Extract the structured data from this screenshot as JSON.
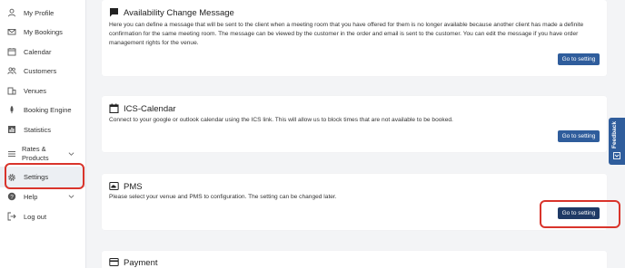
{
  "sidebar": {
    "items": [
      {
        "label": "My Profile",
        "icon": "user-icon"
      },
      {
        "label": "My Bookings",
        "icon": "mail-icon"
      },
      {
        "label": "Calendar",
        "icon": "calendar-icon"
      },
      {
        "label": "Customers",
        "icon": "users-icon"
      },
      {
        "label": "Venues",
        "icon": "building-icon"
      },
      {
        "label": "Booking Engine",
        "icon": "rocket-icon"
      },
      {
        "label": "Statistics",
        "icon": "bar-chart-icon"
      },
      {
        "label": "Rates & Products",
        "icon": "list-icon"
      },
      {
        "label": "Settings",
        "icon": "gear-icon"
      },
      {
        "label": "Help",
        "icon": "help-icon"
      },
      {
        "label": "Log out",
        "icon": "logout-icon"
      }
    ]
  },
  "cards": [
    {
      "title": "Availability Change Message",
      "icon": "message-icon",
      "description": "Here you can define a message that will be sent to the client when a meeting room that you have offered for them is no longer available because another client has made a definite confirmation for the same meeting room. The message can be viewed by the customer in the order and email is sent to the customer. You can edit the message if you have order management rights for the venue.",
      "button": "Go to setting"
    },
    {
      "title": "ICS-Calendar",
      "icon": "calendar-icon",
      "description": "Connect to your google or outlook calendar using the ICS link. This will allow us to block times that are not available to be booked.",
      "button": "Go to setting"
    },
    {
      "title": "PMS",
      "icon": "cloud-icon",
      "description": "Please select your venue and PMS to configuration. The setting can be changed later.",
      "button": "Go to setting"
    },
    {
      "title": "Payment",
      "icon": "credit-card-icon"
    }
  ],
  "feedback": {
    "label": "Feedback"
  },
  "colors": {
    "button": "#2f5d9c",
    "highlight": "#d9342b"
  }
}
